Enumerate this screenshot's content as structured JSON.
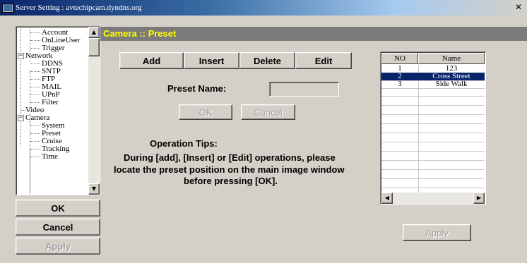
{
  "window": {
    "title": "Server Setting : avtechipcam.dyndns.org",
    "close_glyph": "✕"
  },
  "tree": {
    "items": [
      {
        "label": "Account",
        "level": 2
      },
      {
        "label": "OnLineUser",
        "level": 2
      },
      {
        "label": "Trigger",
        "level": 2
      },
      {
        "label": "Network",
        "level": 1,
        "toggle": "−"
      },
      {
        "label": "DDNS",
        "level": 2
      },
      {
        "label": "SNTP",
        "level": 2
      },
      {
        "label": "FTP",
        "level": 2
      },
      {
        "label": "MAIL",
        "level": 2
      },
      {
        "label": "UPnP",
        "level": 2
      },
      {
        "label": "Filter",
        "level": 2
      },
      {
        "label": "Video",
        "level": 1
      },
      {
        "label": "Camera",
        "level": 1,
        "toggle": "−"
      },
      {
        "label": "System",
        "level": 2
      },
      {
        "label": "Preset",
        "level": 2
      },
      {
        "label": "Cruise",
        "level": 2
      },
      {
        "label": "Tracking",
        "level": 2
      },
      {
        "label": "Time",
        "level": 2
      }
    ],
    "scroll_up_glyph": "▲",
    "scroll_down_glyph": "▼"
  },
  "left_buttons": {
    "ok": "OK",
    "cancel": "Cancel",
    "apply": "Apply"
  },
  "header": {
    "title": "Camera :: Preset"
  },
  "toolbar": {
    "add": "Add",
    "insert": "Insert",
    "delete": "Delete",
    "edit": "Edit"
  },
  "preset_form": {
    "name_label": "Preset Name:",
    "name_value": "",
    "ok": "OK",
    "cancel": "Cancel"
  },
  "tips": {
    "title": "Operation Tips:",
    "line1": "During [add], [Insert] or [Edit] operations, please",
    "line2": "locate the preset position on the main image window",
    "line3": "before pressing [OK]."
  },
  "preset_list": {
    "columns": [
      "NO",
      "Name"
    ],
    "rows": [
      {
        "no": "1",
        "name": "123"
      },
      {
        "no": "2",
        "name": "Cross Street",
        "selected": true
      },
      {
        "no": "3",
        "name": "Side Walk"
      }
    ],
    "scroll_left_glyph": "◀",
    "scroll_right_glyph": "▶"
  },
  "right_apply": "Apply",
  "icons": {
    "app": "app-window-icon",
    "close": "close-icon"
  },
  "colors": {
    "header_bg": "#7b7b7b",
    "header_text": "#ffff00",
    "selection": "#0a246a"
  }
}
